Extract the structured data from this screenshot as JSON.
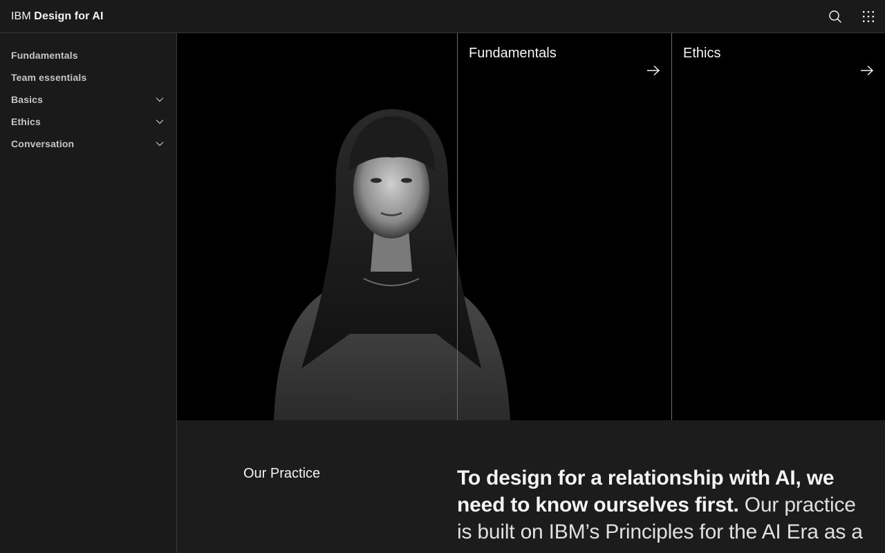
{
  "header": {
    "brand_prefix": "IBM",
    "brand_name": "Design for AI",
    "search_icon": "search-icon",
    "switcher_icon": "app-switcher-icon"
  },
  "sidebar": {
    "items": [
      {
        "label": "Fundamentals",
        "expandable": false
      },
      {
        "label": "Team essentials",
        "expandable": false
      },
      {
        "label": "Basics",
        "expandable": true
      },
      {
        "label": "Ethics",
        "expandable": true
      },
      {
        "label": "Conversation",
        "expandable": true
      }
    ]
  },
  "hero": {
    "tiles": [
      {
        "title": "Fundamentals",
        "icon": "arrow-right-icon"
      },
      {
        "title": "Ethics",
        "icon": "arrow-right-icon"
      }
    ]
  },
  "practice": {
    "label": "Our Practice",
    "headline": "To design for a relationship with AI, we need to know ourselves first.",
    "body": "Our practice is built on IBM’s Principles for the AI Era as a"
  },
  "colors": {
    "background": "#161616",
    "header": "#1a1a1a",
    "hero": "#000000",
    "text": "#f4f4f4",
    "muted": "#c6c6c6",
    "divider": "#393939"
  }
}
